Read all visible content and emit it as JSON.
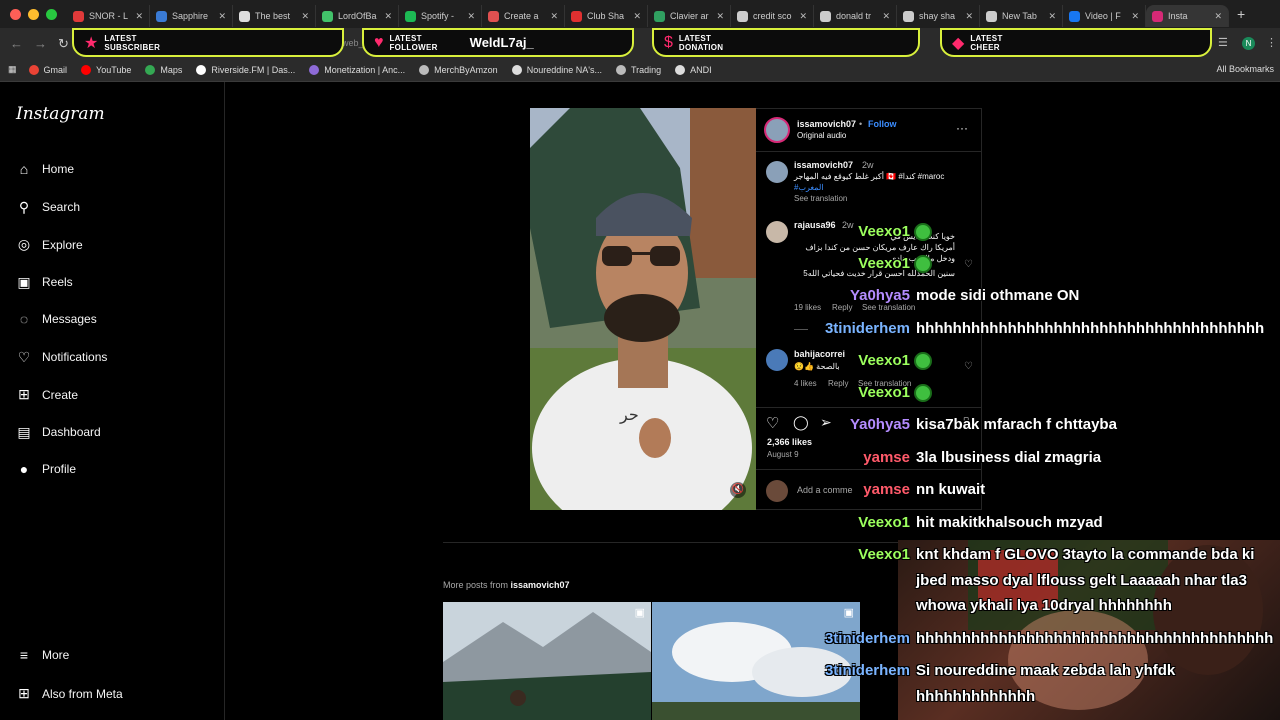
{
  "colors": {
    "accent": "#d9f03c",
    "alert_icon": "#ff2a6d",
    "ig_blue": "#3b8dff",
    "chat_green": "#9cff5e",
    "chat_purple": "#b48cff",
    "chat_blue": "#7ab4ff",
    "chat_red": "#ff5a6a"
  },
  "tabs": [
    {
      "label": "SNOR - L",
      "color": "#e03a3a"
    },
    {
      "label": "Sapphire",
      "color": "#3a7bd5"
    },
    {
      "label": "The best",
      "color": "#ddd"
    },
    {
      "label": "LordOfBa",
      "color": "#42c26a"
    },
    {
      "label": "Spotify -",
      "color": "#1db954"
    },
    {
      "label": "Create a",
      "color": "#e05050"
    },
    {
      "label": "Club Sha",
      "color": "#e03030"
    },
    {
      "label": "Clavier ar",
      "color": "#30a060"
    },
    {
      "label": "credit sco",
      "color": "#ccc"
    },
    {
      "label": "donald tr",
      "color": "#ccc"
    },
    {
      "label": "shay sha",
      "color": "#ccc"
    },
    {
      "label": "New Tab",
      "color": "#ccc"
    },
    {
      "label": "Video | F",
      "color": "#1877f2"
    },
    {
      "label": "Insta",
      "color": "#d62976"
    }
  ],
  "alerts": {
    "subscriber": "LATEST\nSUBSCRIBER",
    "follower": "LATEST\nFOLLOWER",
    "follower_name": "WeldL7aj_",
    "donation": "LATEST\nDONATION",
    "cheer": "LATEST\nCHEER"
  },
  "url_fragment": "web_",
  "bookmarks": [
    {
      "label": "Gmail",
      "color": "#ea4335"
    },
    {
      "label": "YouTube",
      "color": "#ff0000"
    },
    {
      "label": "Maps",
      "color": "#34a853"
    },
    {
      "label": "Riverside.FM | Das...",
      "color": "#ffffff"
    },
    {
      "label": "Monetization | Anc...",
      "color": "#8e6bd8"
    },
    {
      "label": "MerchByAmzon",
      "color": "#bbb"
    },
    {
      "label": "Noureddine NA's...",
      "color": "#ddd"
    },
    {
      "label": "Trading",
      "color": "#bbb"
    },
    {
      "label": "ANDI",
      "color": "#ddd"
    }
  ],
  "all_bookmarks": "All Bookmarks",
  "sidebar": {
    "logo": "Instagram",
    "items": [
      {
        "label": "Home",
        "icon": "home-icon",
        "glyph": "⌂"
      },
      {
        "label": "Search",
        "icon": "search-icon",
        "glyph": "⚲"
      },
      {
        "label": "Explore",
        "icon": "compass-icon",
        "glyph": "◎"
      },
      {
        "label": "Reels",
        "icon": "reels-icon",
        "glyph": "▣"
      },
      {
        "label": "Messages",
        "icon": "messenger-icon",
        "glyph": "◌"
      },
      {
        "label": "Notifications",
        "icon": "heart-icon",
        "glyph": "♡"
      },
      {
        "label": "Create",
        "icon": "plus-square-icon",
        "glyph": "⊞"
      },
      {
        "label": "Dashboard",
        "icon": "dashboard-icon",
        "glyph": "▤"
      },
      {
        "label": "Profile",
        "icon": "avatar-icon",
        "glyph": "●"
      }
    ],
    "more": "More",
    "meta": "Also from Meta"
  },
  "post": {
    "author": "issamovich07",
    "follow": "Follow",
    "audio": "Original audio",
    "caption_user": "issamovich07",
    "caption_time": "2w",
    "caption_text": "أكبر غلط كيوقع فيه المهاجر 🇨🇦 #كندا #maroc",
    "caption_tag": "#المغرب",
    "see_translation": "See translation",
    "comment1_user": "rajausa96",
    "comment1_time": "2w",
    "comment1_l1": "خويا كنت عايش في",
    "comment1_l2": "أمريكا راك عارف مريكان حسن من كندا بزاف",
    "comment1_l3": "ودخل مالي ب هادي",
    "comment1_l4": "5سنين الحمدلله احسن قرار خديت فحياتي الله",
    "comment1_likes": "19 likes",
    "comment1_reply": "Reply",
    "comment1_translate": "See translation",
    "comment2_user": "bahijacorrei",
    "comment2_text": "😟👍 بالصحة",
    "comment2_likes": "4 likes",
    "comment2_reply": "Reply",
    "comment2_translate": "See translation",
    "likes": "2,366 likes",
    "date": "August 9",
    "add_comment": "Add a comme"
  },
  "more_posts_prefix": "More posts from ",
  "more_posts_user": "issamovich07",
  "chat": [
    {
      "user": "Veexo1",
      "msg": "",
      "color": "#9cff5e",
      "emote": true
    },
    {
      "user": "Veexo1",
      "msg": "",
      "color": "#9cff5e",
      "emote": true
    },
    {
      "user": "Ya0hya5",
      "msg": "mode sidi othmane ON",
      "color": "#b48cff",
      "emote": false
    },
    {
      "user": "3tiniderhem",
      "msg": "hhhhhhhhhhhhhhhhhhhhhhhhhhhhhhhhhhhhhh",
      "color": "#7ab4ff",
      "emote": false
    },
    {
      "user": "Veexo1",
      "msg": "",
      "color": "#9cff5e",
      "emote": true
    },
    {
      "user": "Veexo1",
      "msg": "",
      "color": "#9cff5e",
      "emote": true
    },
    {
      "user": "Ya0hya5",
      "msg": "kisa7bak mfarach f chttayba",
      "color": "#b48cff",
      "emote": false
    },
    {
      "user": "yamse",
      "msg": "3la lbusiness dial zmagria",
      "color": "#ff5a6a",
      "emote": false
    },
    {
      "user": "yamse",
      "msg": "nn kuwait",
      "color": "#ff5a6a",
      "emote": false
    },
    {
      "user": "Veexo1",
      "msg": "hit makitkhalsouch mzyad",
      "color": "#9cff5e",
      "emote": false
    },
    {
      "user": "Veexo1",
      "msg": "knt khdam f GLOVO 3tayto la commande bda ki",
      "color": "#9cff5e",
      "emote": false
    },
    {
      "user": "",
      "msg": "jbed masso dyal lflouss gelt Laaaaah nhar tla3",
      "color": "#9cff5e",
      "emote": false
    },
    {
      "user": "",
      "msg": "whowa ykhali lya 10dryal hhhhhhhh",
      "color": "#9cff5e",
      "emote": false
    },
    {
      "user": "3tiniderhem",
      "msg": "hhhhhhhhhhhhhhhhhhhhhhhhhhhhhhhhhhhhhhh",
      "color": "#7ab4ff",
      "emote": false
    },
    {
      "user": "3tiniderhem",
      "msg": "Si noureddine maak zebda lah yhfdk",
      "color": "#7ab4ff",
      "emote": false
    },
    {
      "user": "",
      "msg": "hhhhhhhhhhhhh",
      "color": "#7ab4ff",
      "emote": false
    }
  ]
}
